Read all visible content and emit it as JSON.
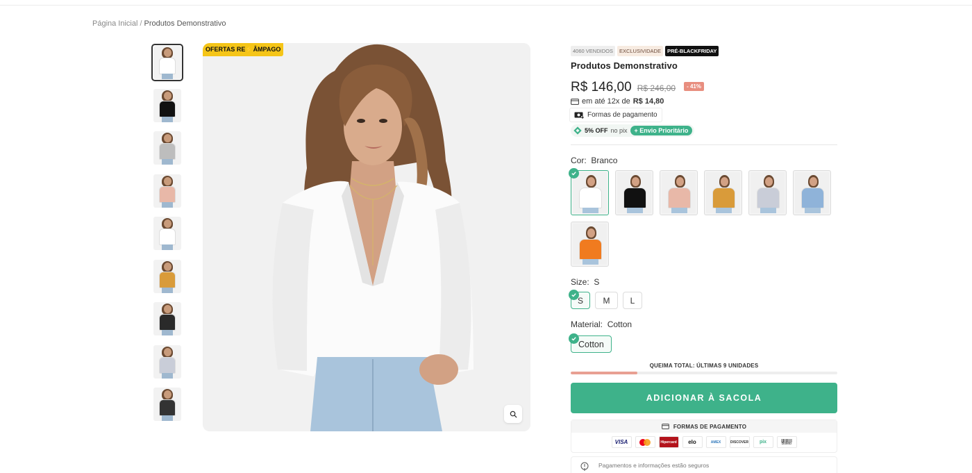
{
  "breadcrumb": {
    "home": "Página Inicial",
    "separator": "/",
    "current": "Produtos Demonstrativo"
  },
  "gallery": {
    "flash_badge_prefix": "OFERTAS RE",
    "flash_badge_suffix": "ÂMPAGO",
    "thumbnails": [
      {
        "top": "#ffffff",
        "active": true
      },
      {
        "top": "#111111",
        "active": false
      },
      {
        "top": "#bdbdbd",
        "active": false
      },
      {
        "top": "#e8b8a8",
        "active": false
      },
      {
        "top": "#ffffff",
        "active": false
      },
      {
        "top": "#d99b3a",
        "active": false
      },
      {
        "top": "#2a2a2a",
        "active": false
      },
      {
        "top": "#c9cdd8",
        "active": false
      },
      {
        "top": "#333333",
        "active": false
      }
    ]
  },
  "product": {
    "badges": {
      "sold": "4060 VENDIDOS",
      "exclusive": "EXCLUSIVIDADE",
      "black": "PRÉ-BLACKFRIDAY"
    },
    "title": "Produtos Demonstrativo",
    "price": "R$ 146,00",
    "old_price": "R$ 246,00",
    "discount": "- 41%",
    "installments_text": "em até 12x de",
    "installments_value": "R$ 14,80",
    "payment_forms_label": "Formas de pagamento",
    "pix_off": "5% OFF",
    "pix_label": "no pix",
    "priority_label": "+ Envio Prioritário"
  },
  "options": {
    "color": {
      "label": "Cor:",
      "value": "Branco",
      "swatches": [
        {
          "top": "#ffffff",
          "selected": true
        },
        {
          "top": "#111111",
          "selected": false
        },
        {
          "top": "#e8b8a8",
          "selected": false
        },
        {
          "top": "#d99b3a",
          "selected": false
        },
        {
          "top": "#c9cdd8",
          "selected": false
        },
        {
          "top": "#8fb3d9",
          "selected": false
        },
        {
          "top": "#f07b1f",
          "selected": false
        }
      ]
    },
    "size": {
      "label": "Size:",
      "value": "S",
      "values": [
        "S",
        "M",
        "L"
      ]
    },
    "material": {
      "label": "Material:",
      "value": "Cotton",
      "values": [
        "Cotton"
      ]
    }
  },
  "stock": {
    "label": "QUEIMA TOTAL: ÚLTIMAS 9 UNIDADES",
    "level_percent": 25
  },
  "cart": {
    "add_label": "ADICIONAR À SACOLA"
  },
  "payment": {
    "header": "FORMAS DE PAGAMENTO",
    "methods": [
      "VISA",
      "Mastercard",
      "Hipercard",
      "elo",
      "AMEX",
      "DISCOVER",
      "pix",
      "Boleto"
    ],
    "secure_text": "Pagamentos e informações estão seguros"
  },
  "colors": {
    "accent": "#3eb28a",
    "flash": "#f5c518",
    "discount": "#e88e7f"
  }
}
